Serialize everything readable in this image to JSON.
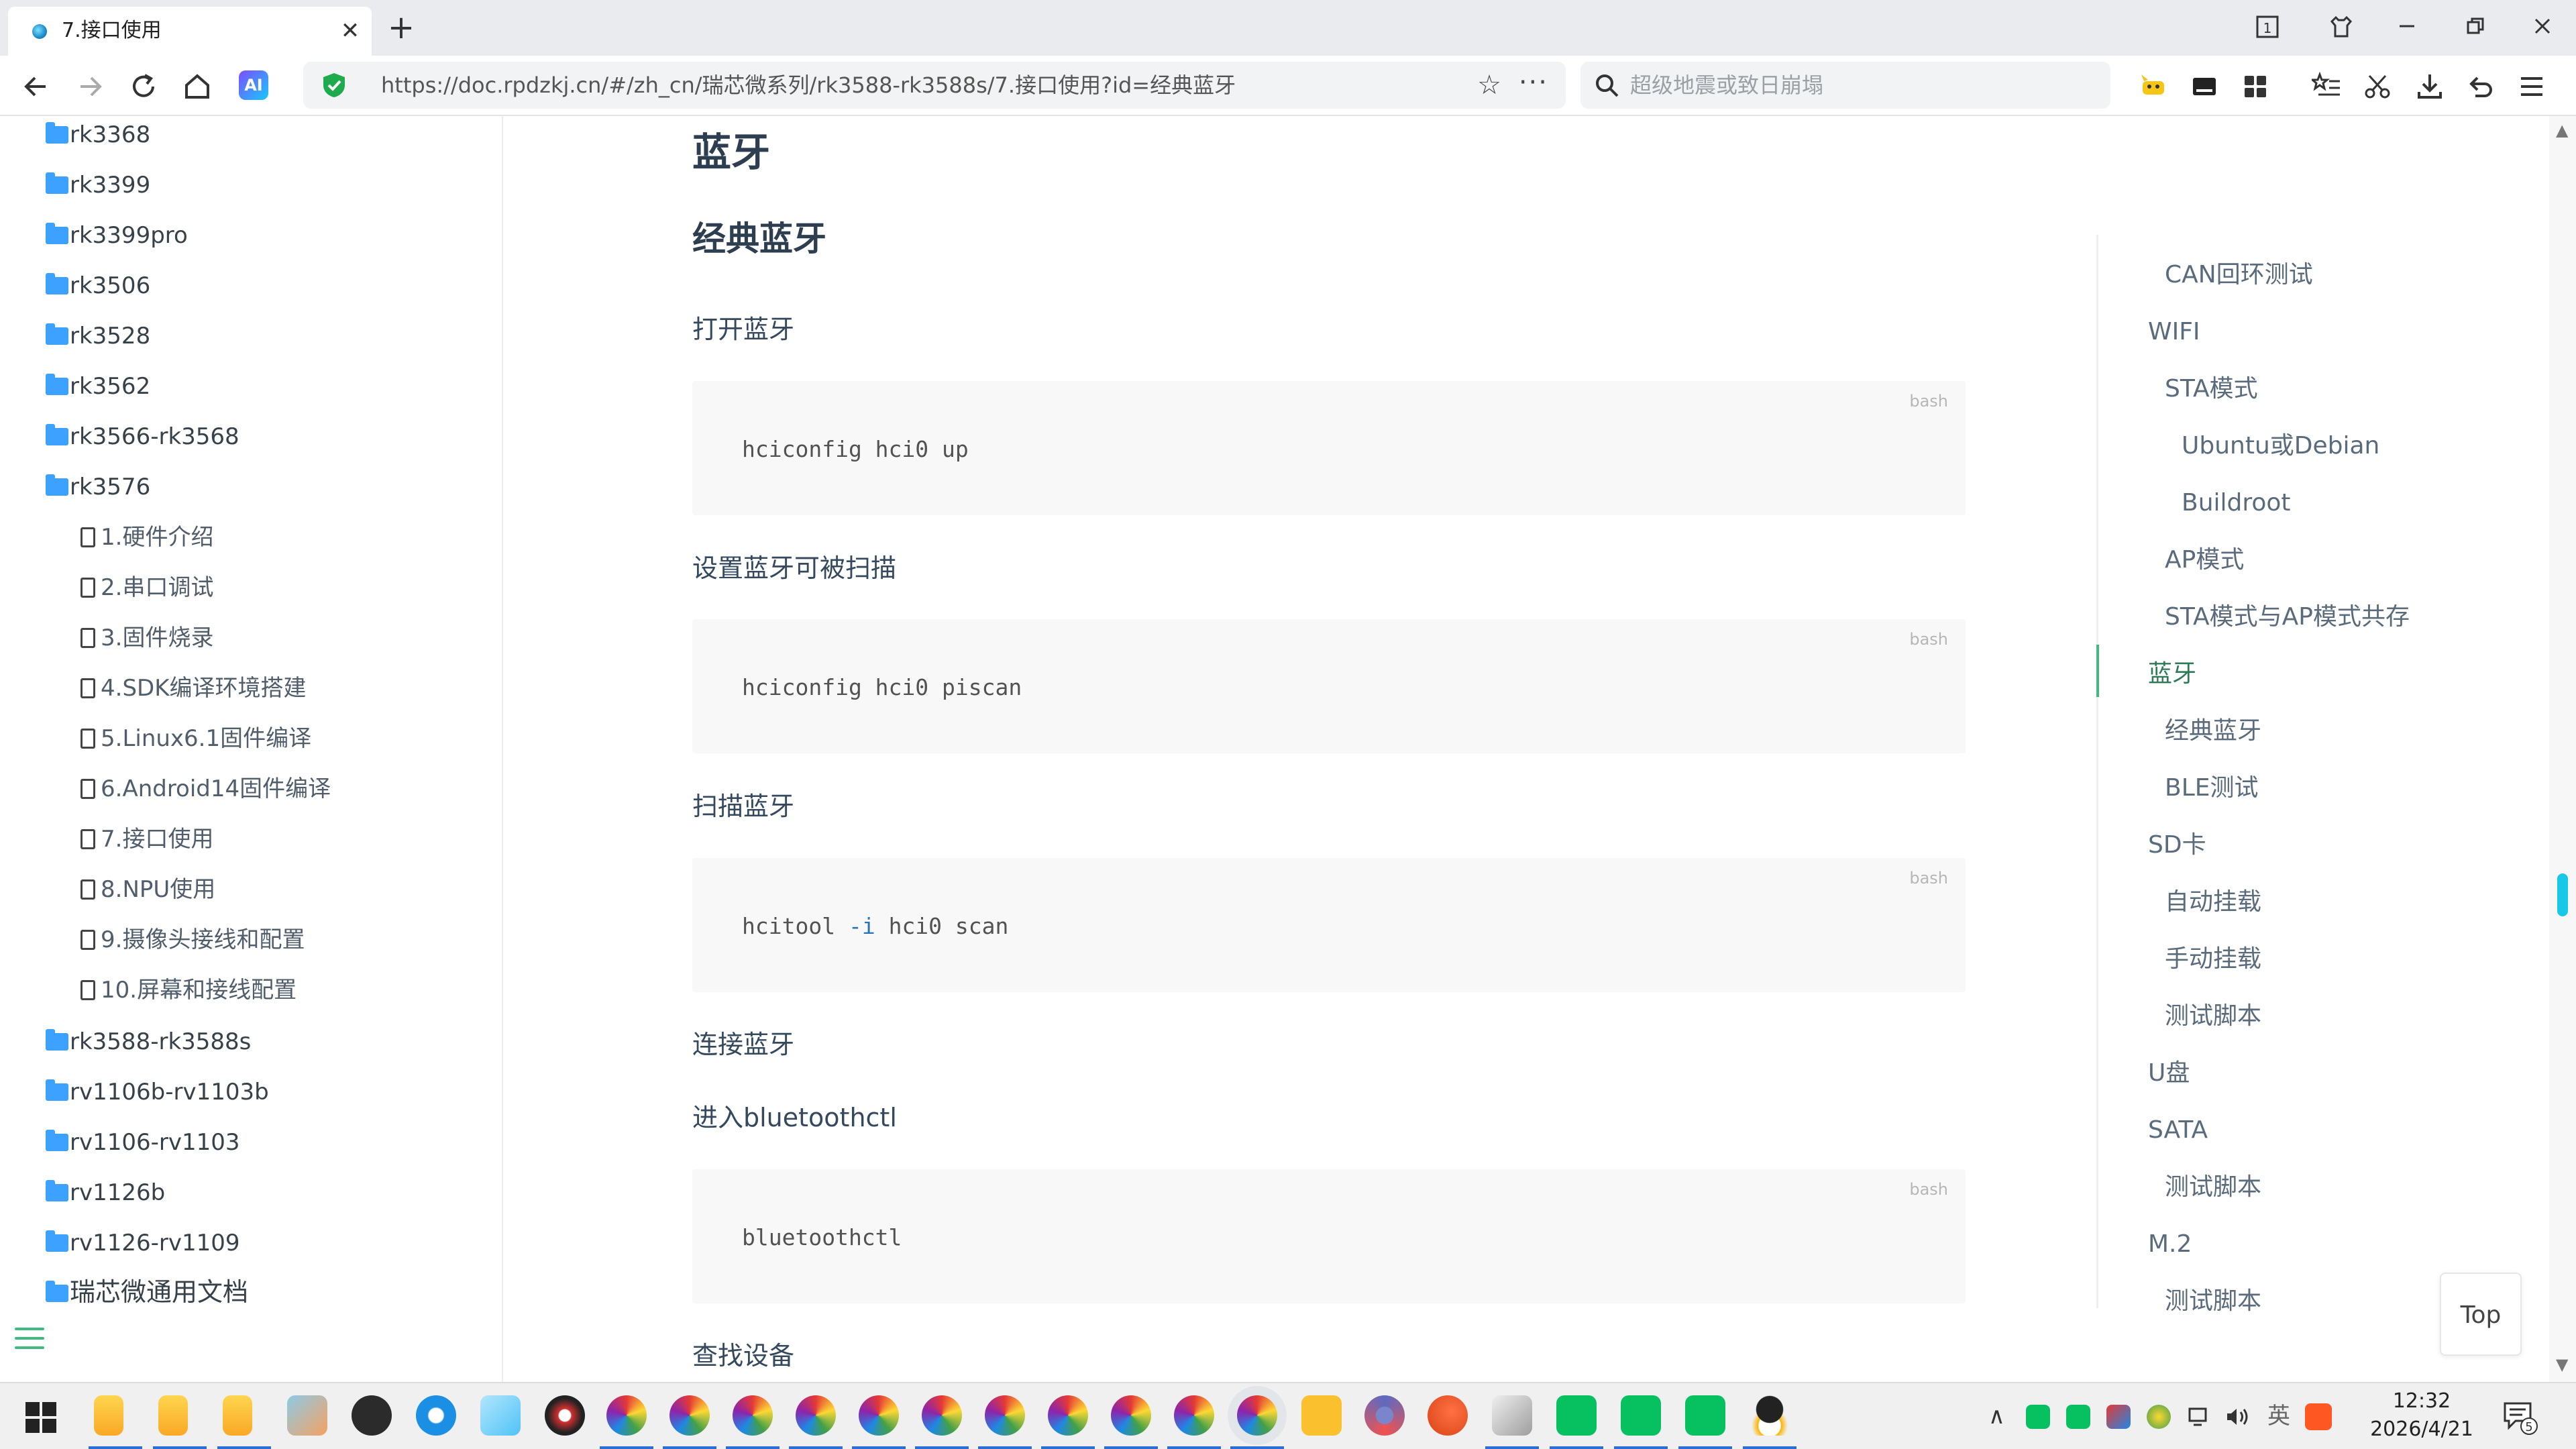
{
  "browser": {
    "tab_title": "7.接口使用",
    "tab_close": "✕",
    "new_tab": "+",
    "url": "https://doc.rpdzkj.cn/#/zh_cn/瑞芯微系列/rk3588-rk3588s/7.接口使用?id=经典蓝牙",
    "search_placeholder": "超级地震或致日崩塌",
    "ai_label": "AI",
    "window_badge": "1"
  },
  "sidebar": {
    "folders_top": [
      "rk3368",
      "rk3399",
      "rk3399pro",
      "rk3506",
      "rk3528",
      "rk3562",
      "rk3566-rk3568",
      "rk3576"
    ],
    "files": [
      "1.硬件介绍",
      "2.串口调试",
      "3.固件烧录",
      "4.SDK编译环境搭建",
      "5.Linux6.1固件编译",
      "6.Android14固件编译",
      "7.接口使用",
      "8.NPU使用",
      "9.摄像头接线和配置",
      "10.屏幕和接线配置"
    ],
    "folders_bottom": [
      "rk3588-rk3588s",
      "rv1106b-rv1103b",
      "rv1106-rv1103",
      "rv1126b",
      "rv1126-rv1109",
      "瑞芯微通用文档"
    ]
  },
  "content": {
    "h1": "蓝牙",
    "h2": "经典蓝牙",
    "sections": [
      {
        "heading": "打开蓝牙",
        "code_lang": "bash",
        "code": "hciconfig hci0 up"
      },
      {
        "heading": "设置蓝牙可被扫描",
        "code_lang": "bash",
        "code": "hciconfig hci0 piscan"
      },
      {
        "heading": "扫描蓝牙",
        "code_lang": "bash",
        "code_cmd": "hcitool ",
        "code_flag": "-i",
        "code_rest": " hci0 scan"
      },
      {
        "heading": "连接蓝牙"
      },
      {
        "heading": "进入bluetoothctl",
        "code_lang": "bash",
        "code": "bluetoothctl"
      },
      {
        "heading": "查找设备"
      }
    ]
  },
  "toc": {
    "items": [
      {
        "label": "CAN回环测试",
        "level": 2
      },
      {
        "label": "WIFI",
        "level": 1
      },
      {
        "label": "STA模式",
        "level": 2
      },
      {
        "label": "Ubuntu或Debian",
        "level": 3
      },
      {
        "label": "Buildroot",
        "level": 3
      },
      {
        "label": "AP模式",
        "level": 2
      },
      {
        "label": "STA模式与AP模式共存",
        "level": 2
      },
      {
        "label": "蓝牙",
        "level": 1,
        "active": true
      },
      {
        "label": "经典蓝牙",
        "level": 2
      },
      {
        "label": "BLE测试",
        "level": 2
      },
      {
        "label": "SD卡",
        "level": 1
      },
      {
        "label": "自动挂载",
        "level": 2
      },
      {
        "label": "手动挂载",
        "level": 2
      },
      {
        "label": "测试脚本",
        "level": 2
      },
      {
        "label": "U盘",
        "level": 1
      },
      {
        "label": "SATA",
        "level": 1
      },
      {
        "label": "测试脚本",
        "level": 2
      },
      {
        "label": "M.2",
        "level": 1
      },
      {
        "label": "测试脚本",
        "level": 2
      }
    ],
    "accent_color": "#42b983"
  },
  "top_button": "Top",
  "taskbar": {
    "time": "12:32",
    "date": "2026/4/21",
    "notification_count": "5",
    "ime": "英"
  }
}
